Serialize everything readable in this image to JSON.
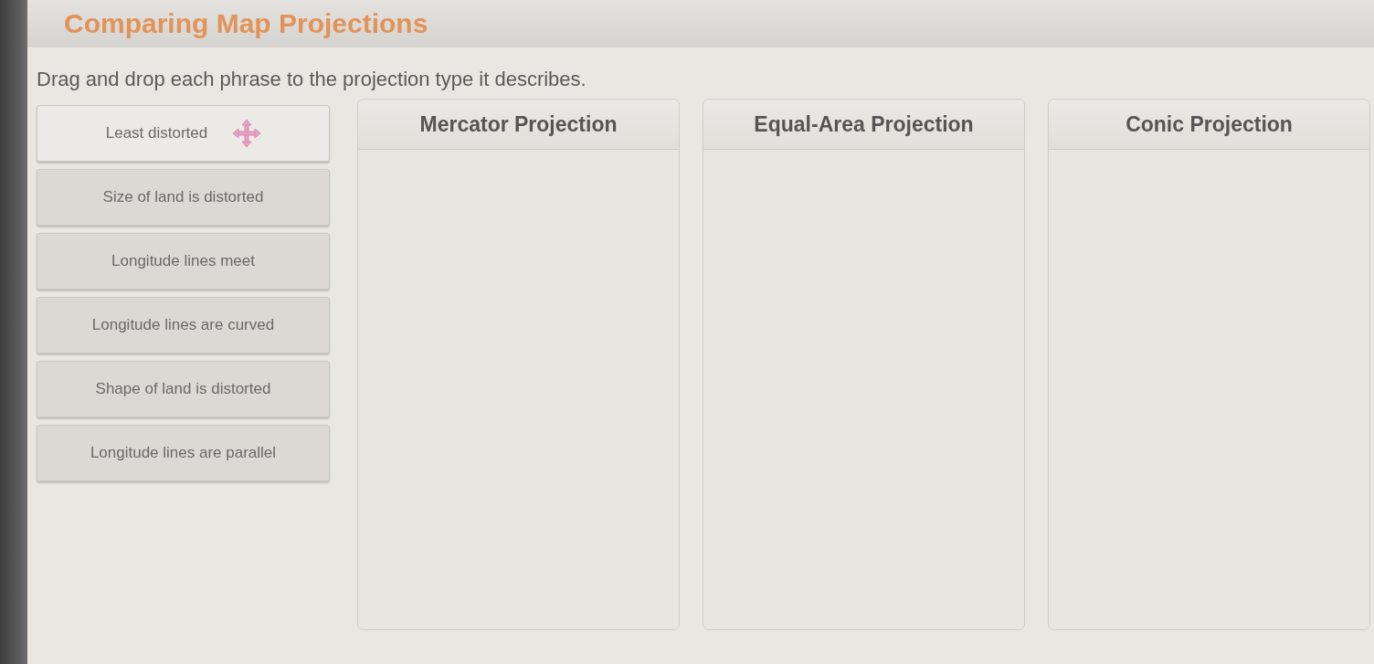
{
  "header": {
    "title": "Comparing Map Projections"
  },
  "instructions": "Drag and drop each phrase to the projection type it describes.",
  "phrases": [
    {
      "label": "Least distorted",
      "selected": true
    },
    {
      "label": "Size of land is distorted",
      "selected": false
    },
    {
      "label": "Longitude lines meet",
      "selected": false
    },
    {
      "label": "Longitude lines are curved",
      "selected": false
    },
    {
      "label": "Shape of land is distorted",
      "selected": false
    },
    {
      "label": "Longitude lines are parallel",
      "selected": false
    }
  ],
  "categories": [
    {
      "title": "Mercator Projection"
    },
    {
      "title": "Equal-Area Projection"
    },
    {
      "title": "Conic Projection"
    }
  ]
}
